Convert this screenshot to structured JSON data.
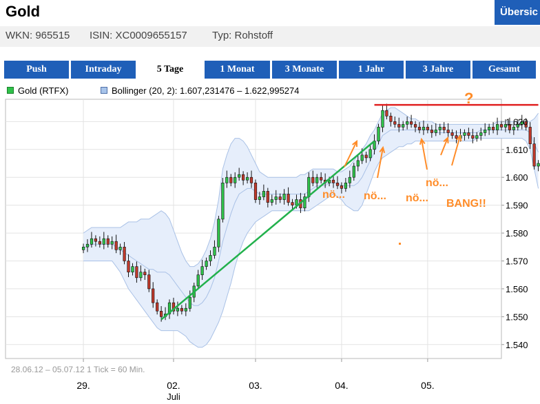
{
  "header": {
    "title": "Gold",
    "overview_label": "Übersic",
    "meta": {
      "wkn": "WKN: 965515",
      "isin": "ISIN: XC0009655157",
      "typ": "Typ: Rohstoff"
    }
  },
  "tabs": [
    {
      "label": "Push",
      "active": false
    },
    {
      "label": "Intraday",
      "active": false
    },
    {
      "label": "5 Tage",
      "active": true
    },
    {
      "label": "1 Monat",
      "active": false
    },
    {
      "label": "3 Monate",
      "active": false
    },
    {
      "label": "1 Jahr",
      "active": false
    },
    {
      "label": "3 Jahre",
      "active": false
    },
    {
      "label": "Gesamt",
      "active": false
    }
  ],
  "colors": {
    "tab_blue": "#1f5fb8",
    "candle_up": "#2fc24a",
    "candle_down": "#c0392b",
    "band_fill": "#e6eefb",
    "band_line": "#a9c1e6",
    "trend_green": "#22b14c",
    "resistance_red": "#e02020",
    "annotation_orange": "#ff8c28"
  },
  "legend": {
    "gold": "Gold (RTFX)",
    "bollinger": "Bollinger (20, 2): 1.607,231476 – 1.622,995274"
  },
  "footer_note": "28.06.12 – 05.07.12   1 Tick = 60 Min.",
  "chart_data": {
    "type": "candlestick",
    "y_ticks": [
      "1.540",
      "1.550",
      "1.560",
      "1.570",
      "1.580",
      "1.590",
      "1.600",
      "1.610",
      "1.620"
    ],
    "ylim": [
      1535,
      1628
    ],
    "x_ticks": [
      {
        "label": "29.",
        "sub": "",
        "x": 0
      },
      {
        "label": "02.",
        "sub": "Juli",
        "x": 22
      },
      {
        "label": "03.",
        "sub": "",
        "x": 42
      },
      {
        "label": "04.",
        "sub": "",
        "x": 63
      },
      {
        "label": "05.",
        "sub": "",
        "x": 84
      }
    ],
    "xlim": [
      -19,
      102
    ],
    "close": [
      1575,
      1576,
      1578,
      1577,
      1576,
      1578,
      1576,
      1577,
      1574,
      1575,
      1570,
      1566,
      1568,
      1564,
      1566,
      1565,
      1560,
      1555,
      1552,
      1550,
      1551,
      1555,
      1552,
      1553,
      1552,
      1553,
      1557,
      1561,
      1565,
      1568,
      1570,
      1572,
      1575,
      1585,
      1598,
      1600,
      1598,
      1600,
      1601,
      1599,
      1600,
      1598,
      1592,
      1593,
      1595,
      1591,
      1592,
      1593,
      1592,
      1594,
      1591,
      1590,
      1592,
      1589,
      1593,
      1600,
      1598,
      1600,
      1599,
      1598,
      1599,
      1598,
      1597,
      1596,
      1598,
      1600,
      1604,
      1606,
      1608,
      1607,
      1610,
      1613,
      1618,
      1624,
      1622,
      1620,
      1619,
      1618,
      1619,
      1620,
      1619,
      1618,
      1617,
      1618,
      1617,
      1616,
      1617,
      1618,
      1617,
      1616,
      1615,
      1614,
      1615,
      1616,
      1615,
      1614,
      1615,
      1616,
      1617,
      1618,
      1617,
      1619,
      1618,
      1619,
      1617,
      1618,
      1619,
      1620,
      1618,
      1612,
      1604,
      1605
    ],
    "bb_upper": [
      1580,
      1581,
      1582,
      1582,
      1582,
      1582,
      1582,
      1582,
      1582,
      1582,
      1583,
      1584,
      1584,
      1584,
      1585,
      1585,
      1585,
      1586,
      1587,
      1588,
      1587,
      1585,
      1581,
      1577,
      1573,
      1570,
      1568,
      1568,
      1569,
      1571,
      1574,
      1578,
      1584,
      1592,
      1603,
      1608,
      1612,
      1614,
      1614,
      1613,
      1611,
      1608,
      1605,
      1602,
      1601,
      1600,
      1600,
      1600,
      1600,
      1600,
      1600,
      1600,
      1600,
      1601,
      1601,
      1602,
      1603,
      1603,
      1603,
      1603,
      1603,
      1603,
      1602,
      1602,
      1603,
      1604,
      1606,
      1608,
      1610,
      1612,
      1615,
      1617,
      1620,
      1623,
      1624,
      1625,
      1625,
      1624,
      1623,
      1622,
      1621,
      1621,
      1620,
      1620,
      1620,
      1620,
      1619,
      1619,
      1619,
      1619,
      1619,
      1619,
      1619,
      1619,
      1619,
      1619,
      1619,
      1619,
      1619,
      1619,
      1619,
      1620,
      1620,
      1620,
      1620,
      1620,
      1620,
      1620,
      1620,
      1620,
      1621,
      1623
    ],
    "bb_lower": [
      1570,
      1570,
      1570,
      1570,
      1570,
      1570,
      1570,
      1570,
      1568,
      1566,
      1563,
      1560,
      1558,
      1556,
      1554,
      1552,
      1550,
      1548,
      1546,
      1545,
      1545,
      1545,
      1545,
      1545,
      1544,
      1543,
      1541,
      1540,
      1539,
      1539,
      1540,
      1542,
      1545,
      1548,
      1552,
      1557,
      1562,
      1568,
      1573,
      1577,
      1580,
      1582,
      1584,
      1585,
      1586,
      1587,
      1588,
      1588,
      1588,
      1588,
      1588,
      1588,
      1588,
      1588,
      1588,
      1588,
      1589,
      1590,
      1591,
      1592,
      1593,
      1594,
      1593,
      1592,
      1590,
      1589,
      1588,
      1588,
      1590,
      1594,
      1598,
      1602,
      1605,
      1607,
      1608,
      1609,
      1610,
      1611,
      1611,
      1612,
      1612,
      1613,
      1613,
      1613,
      1613,
      1613,
      1613,
      1613,
      1613,
      1613,
      1613,
      1613,
      1613,
      1613,
      1613,
      1613,
      1614,
      1614,
      1614,
      1614,
      1614,
      1614,
      1614,
      1614,
      1614,
      1614,
      1614,
      1614,
      1613,
      1610,
      1603,
      1596
    ],
    "bb_mid": [
      1575,
      1575,
      1576,
      1576,
      1576,
      1576,
      1576,
      1576,
      1575,
      1574,
      1573,
      1572,
      1571,
      1570,
      1569,
      1568,
      1567,
      1567,
      1566,
      1566,
      1566,
      1565,
      1563,
      1561,
      1559,
      1557,
      1555,
      1554,
      1554,
      1555,
      1557,
      1560,
      1564,
      1570,
      1577,
      1582,
      1587,
      1591,
      1594,
      1595,
      1596,
      1596,
      1595,
      1594,
      1594,
      1594,
      1594,
      1594,
      1594,
      1594,
      1594,
      1594,
      1594,
      1594,
      1594,
      1595,
      1596,
      1597,
      1597,
      1597,
      1598,
      1598,
      1598,
      1597,
      1597,
      1597,
      1597,
      1598,
      1600,
      1603,
      1606,
      1609,
      1612,
      1615,
      1616,
      1617,
      1617,
      1617,
      1617,
      1617,
      1617,
      1617,
      1617,
      1617,
      1617,
      1617,
      1616,
      1616,
      1616,
      1616,
      1616,
      1616,
      1616,
      1616,
      1616,
      1616,
      1616,
      1617,
      1617,
      1617,
      1617,
      1617,
      1617,
      1617,
      1617,
      1617,
      1617,
      1617,
      1617,
      1616,
      1612,
      1609
    ],
    "trendline": {
      "from": [
        1549,
        19
      ],
      "to": [
        1613,
        71
      ]
    },
    "resistance": {
      "value": 1626,
      "from": 71,
      "to": 111
    },
    "annotations": [
      "nö...",
      "nö...",
      "nö...",
      "nö...",
      "BANG!!",
      "?"
    ]
  }
}
